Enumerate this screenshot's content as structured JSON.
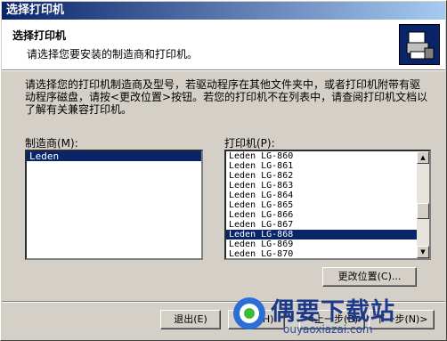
{
  "window": {
    "title": "选择打印机"
  },
  "header": {
    "title": "选择打印机",
    "subtitle": "请选择您要安装的制造商和打印机。",
    "icon": "printer-wizard-icon"
  },
  "instructions": [
    "请选择您的打印机制造商及型号，若驱动程序在其他文件夹中，或者打印机附带有驱",
    "动程序磁盘，请按<更改位置>按钮。若您的打印机不在列表中，请查阅打印机文档以",
    "了解有关兼容打印机。"
  ],
  "manufacturer": {
    "label": "制造商(M):",
    "items": [
      "Leden"
    ],
    "selected": "Leden"
  },
  "printer": {
    "label": "打印机(P):",
    "items": [
      "Leden LG-860",
      "Leden LG-861",
      "Leden LG-862",
      "Leden LG-863",
      "Leden LG-864",
      "Leden LG-865",
      "Leden LG-866",
      "Leden LG-867",
      "Leden LG-868",
      "Leden LG-869",
      "Leden LG-870"
    ],
    "selected": "Leden LG-868"
  },
  "buttons": {
    "change_location": "更改位置(C)...",
    "exit": "退出(E)",
    "help": "帮助(H)",
    "back": "<上一步(B)",
    "next": "下一步(N)>"
  },
  "watermark": {
    "brand": "偶要下载站",
    "url": "ouyaoxiazai.com"
  }
}
